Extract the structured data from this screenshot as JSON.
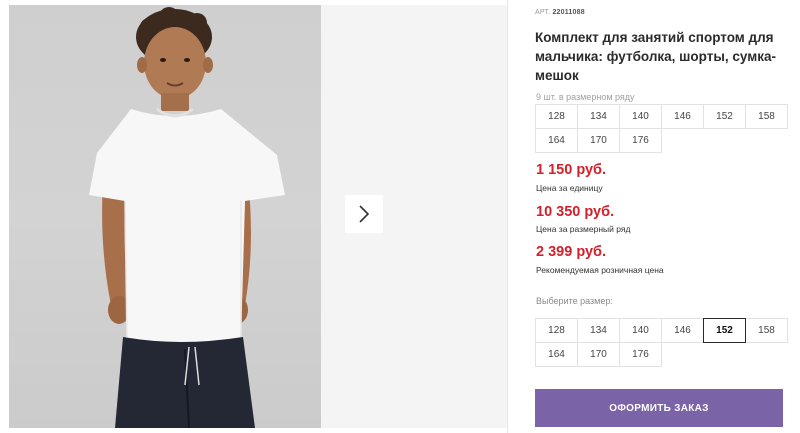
{
  "gallery": {
    "next_icon": "chevron-right-icon"
  },
  "product": {
    "sku_label": "АРТ.",
    "sku": "22011088",
    "title": "Комплект для занятий спортом для мальчика: футболка, шорты, сумка-мешок",
    "range_note": "9 шт. в размерном ряду",
    "range_sizes": [
      "128",
      "134",
      "140",
      "146",
      "152",
      "158",
      "164",
      "170",
      "176"
    ],
    "unit_price": "1 150 руб.",
    "unit_price_label": "Цена за единицу",
    "range_price": "10 350 руб.",
    "range_price_label": "Цена за размерный ряд",
    "retail_price": "2 399 руб.",
    "retail_price_label": "Рекомендуемая розничная цена",
    "choose_size_label": "Выберите размер:",
    "selectable_sizes": [
      "128",
      "134",
      "140",
      "146",
      "152",
      "158",
      "164",
      "170",
      "176"
    ],
    "selected_size": "152",
    "order_button": "ОФОРМИТЬ ЗАКАЗ"
  },
  "colors": {
    "price": "#d4202a",
    "button": "#7a63a6"
  }
}
